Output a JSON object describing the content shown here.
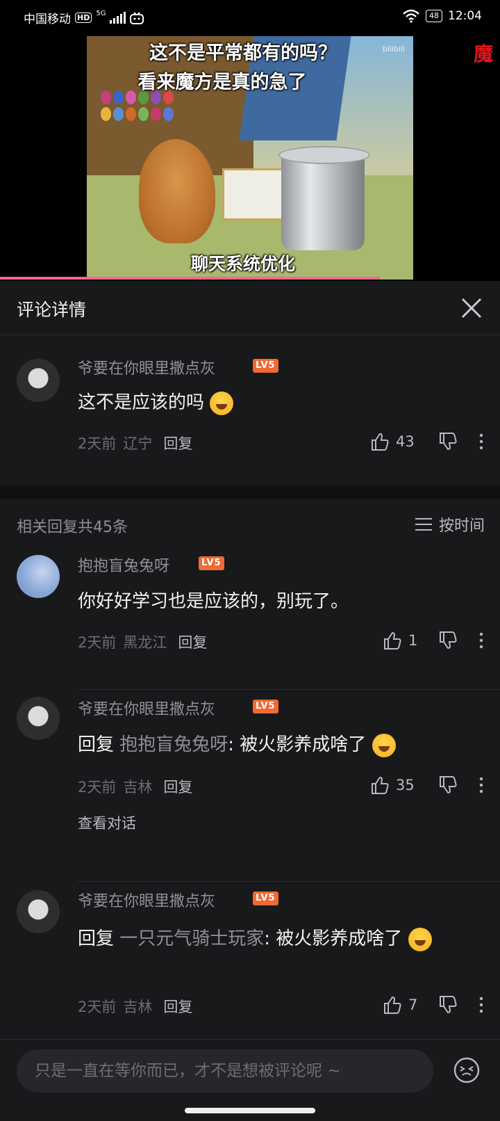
{
  "status_bar": {
    "carrier": "中国移动",
    "hd": "HD",
    "network": "5G",
    "battery": "48",
    "time": "12:04"
  },
  "video": {
    "caption_top": "这不是平常都有的吗？",
    "caption_second": "看来魔方是真的急了",
    "caption_bottom": "聊天系统优化",
    "side_text": "魔",
    "progress_fraction": 0.76
  },
  "panel": {
    "title": "评论详情"
  },
  "main_comment": {
    "username": "爷要在你眼里撒点灰",
    "level": "LV5",
    "text": "这不是应该的吗",
    "time": "2天前",
    "location": "辽宁",
    "reply_label": "回复",
    "likes": "43"
  },
  "related": {
    "count_label": "相关回复共45条",
    "sort_label": "按时间"
  },
  "replies": [
    {
      "username": "抱抱盲兔兔呀",
      "level": "LV5",
      "text": "你好好学习也是应该的，别玩了。",
      "time": "2天前",
      "location": "黑龙江",
      "reply_label": "回复",
      "likes": "1"
    },
    {
      "username": "爷要在你眼里撒点灰",
      "level": "LV5",
      "prefix": "回复 ",
      "mention": "抱抱盲兔兔呀",
      "text": ": 被火影养成啥了",
      "time": "2天前",
      "location": "吉林",
      "reply_label": "回复",
      "likes": "35",
      "view_conversation": "查看对话"
    },
    {
      "username": "爷要在你眼里撒点灰",
      "level": "LV5",
      "prefix": "回复 ",
      "mention": "一只元气骑士玩家",
      "text": ": 被火影养成啥了",
      "time": "2天前",
      "location": "吉林",
      "reply_label": "回复",
      "likes": "7"
    }
  ],
  "input": {
    "placeholder": "只是一直在等你而已，才不是想被评论呢 ~"
  }
}
